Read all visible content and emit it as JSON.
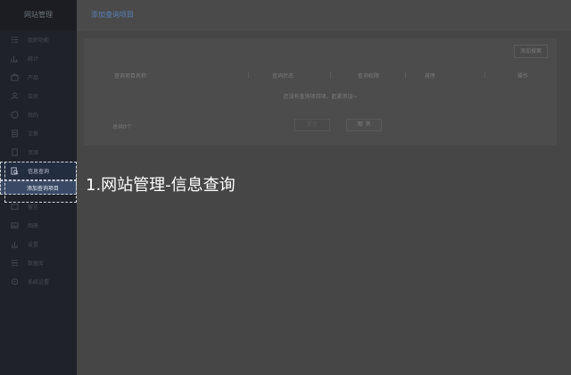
{
  "sidebar": {
    "brand": "网站管理",
    "items": [
      {
        "label": "组织功能",
        "icon": "list-icon"
      },
      {
        "label": "统计",
        "icon": "chart-icon"
      },
      {
        "label": "产品",
        "icon": "box-icon"
      },
      {
        "label": "会员",
        "icon": "users-icon"
      },
      {
        "label": "我的",
        "icon": "user-circle-icon"
      },
      {
        "label": "文章",
        "icon": "document-icon"
      },
      {
        "label": "资源",
        "icon": "file-icon"
      },
      {
        "label": "信息查询",
        "icon": "search-doc-icon"
      },
      {
        "label": "留言",
        "icon": "message-icon"
      },
      {
        "label": "图册",
        "icon": "image-icon"
      },
      {
        "label": "设置",
        "icon": "bar-chart-icon"
      },
      {
        "label": "数据库",
        "icon": "database-icon"
      },
      {
        "label": "系统设置",
        "icon": "gear-icon"
      }
    ],
    "sub_item": "添加查询项目"
  },
  "topbar": {
    "title": "添加查询项目"
  },
  "panel": {
    "add_button": "添加搜索",
    "columns": [
      "查询项目名称",
      "查询状态",
      "查询权限",
      "排序",
      "操作"
    ],
    "empty_message": "还没有查询项目项，赶紧添加~",
    "total": "总共0个",
    "prev_button": "提交",
    "next_button": "取 消"
  },
  "caption": "1.网站管理-信息查询",
  "colors": {
    "accent": "#5b7fb8",
    "sidebar_bg": "#1f2228",
    "overlay": "#464646"
  }
}
